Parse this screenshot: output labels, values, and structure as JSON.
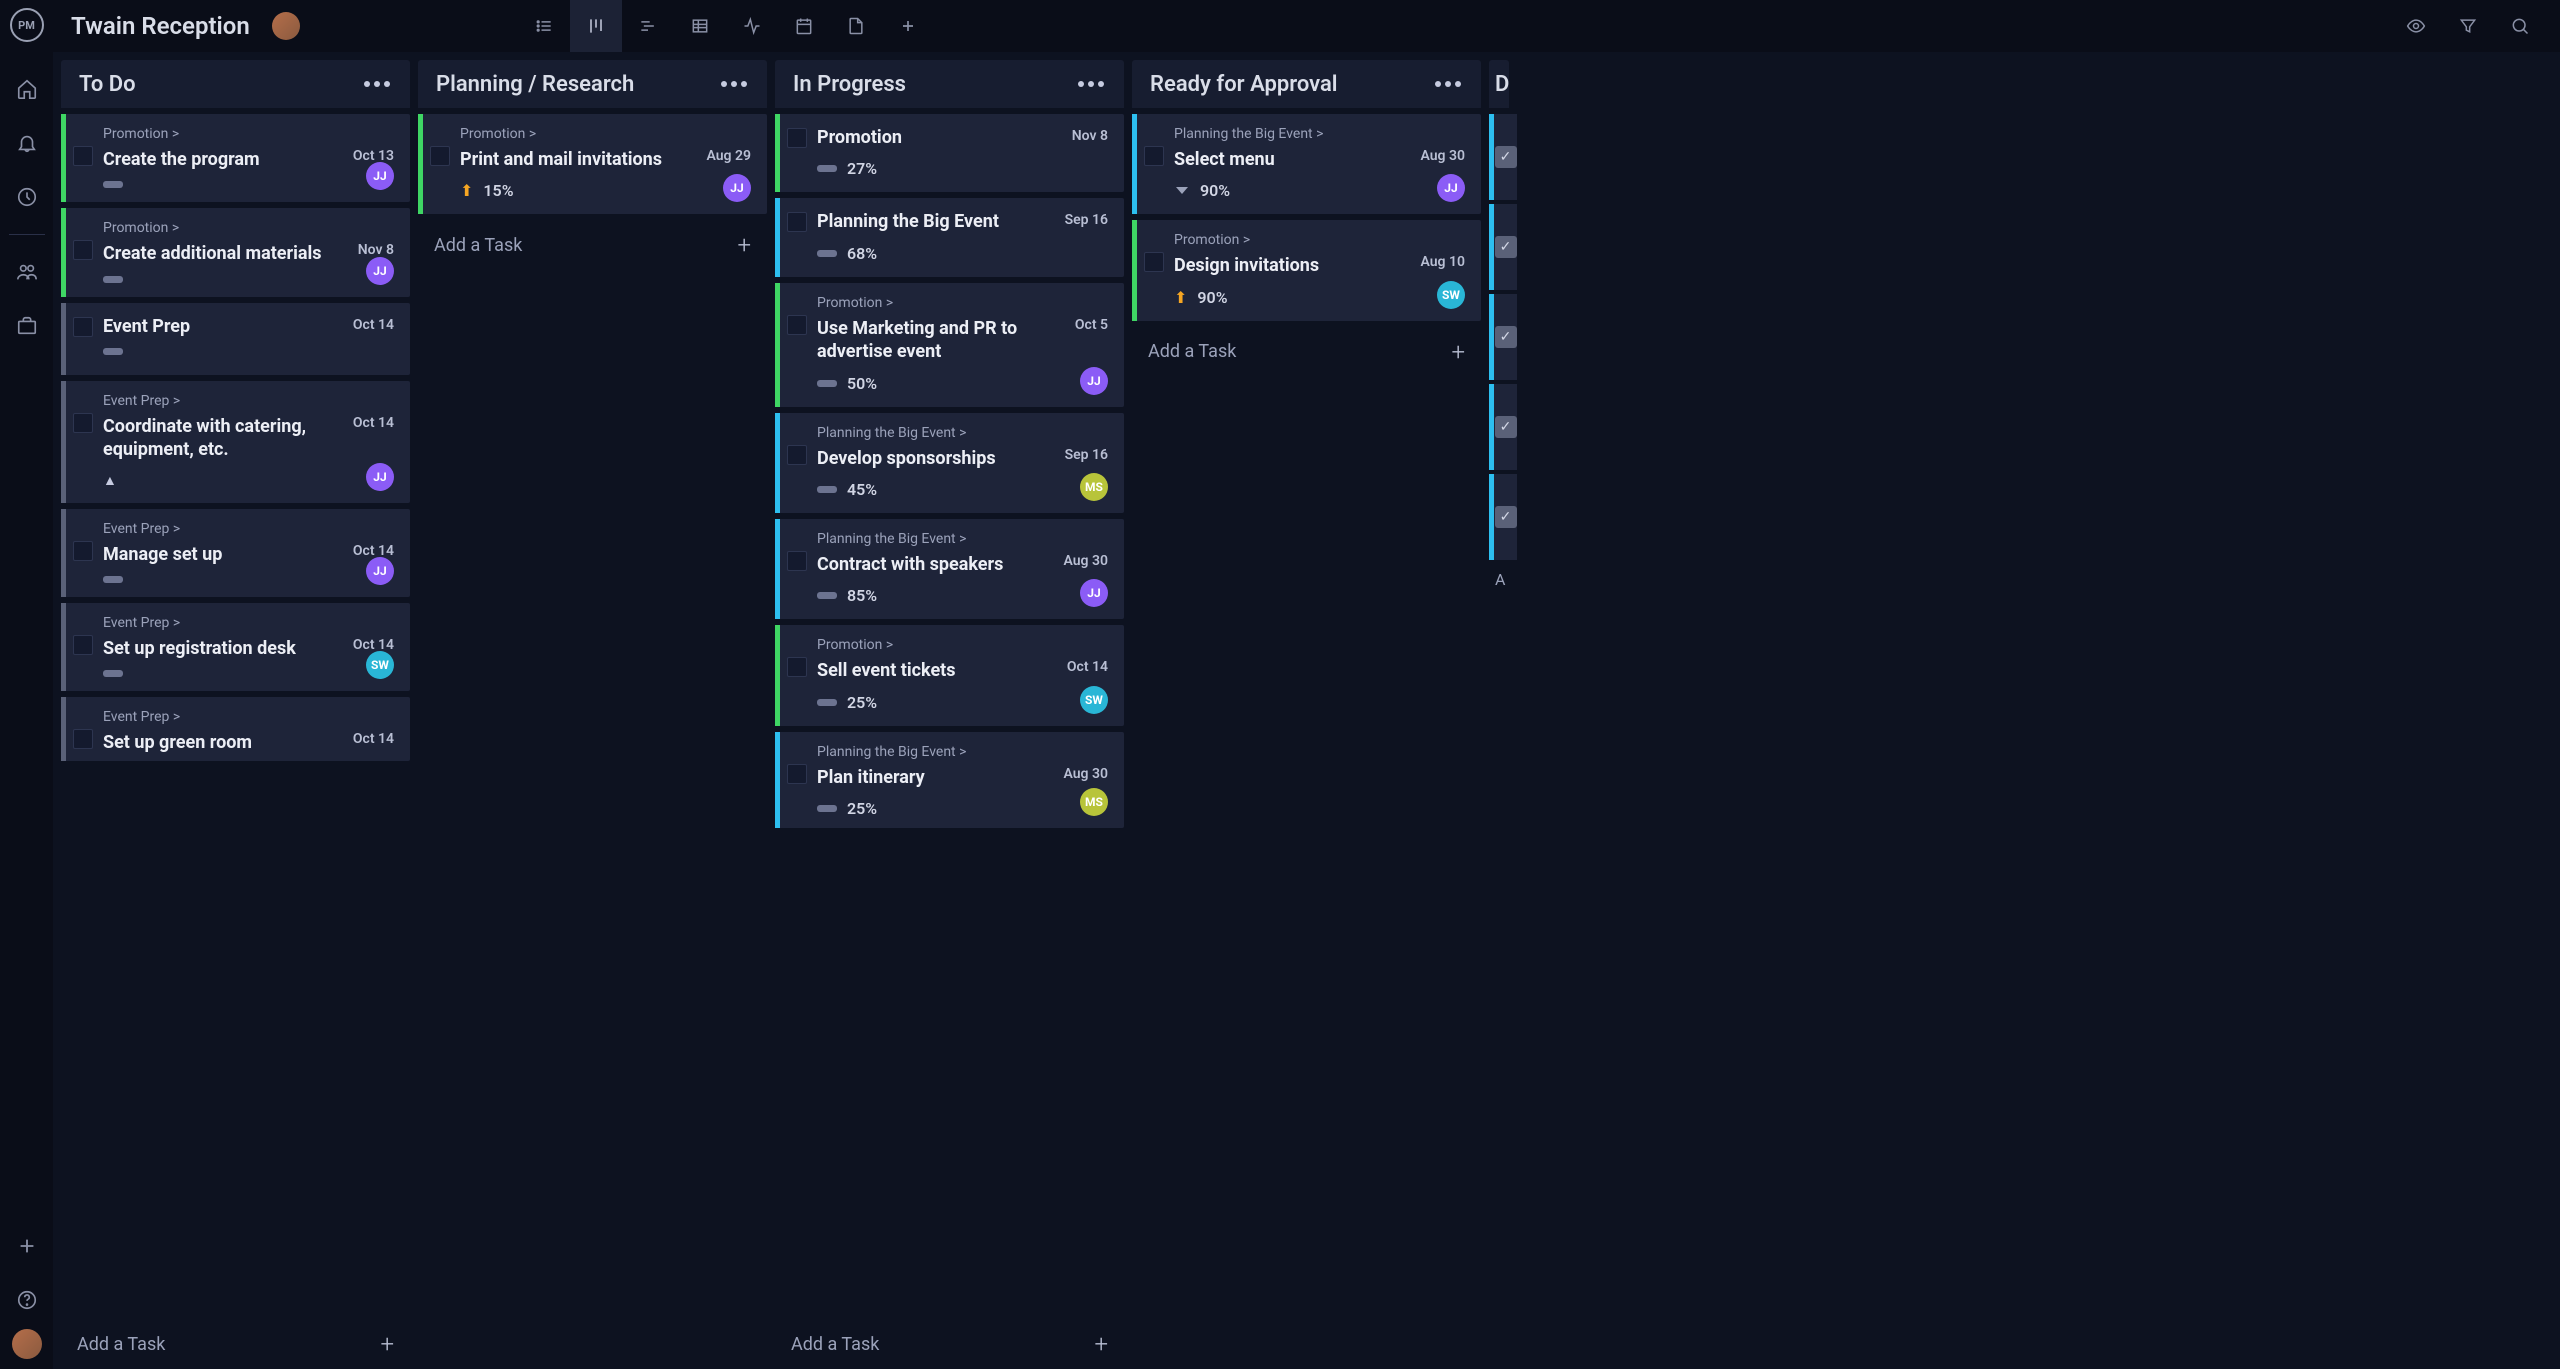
{
  "project": {
    "title": "Twain Reception"
  },
  "columns": [
    {
      "title": "To Do",
      "add_label": "Add a Task",
      "cards": [
        {
          "parent": "Promotion >",
          "title": "Create the program",
          "date": "Oct 13",
          "avatar": "JJ",
          "stripe": "green",
          "progress_bar": true
        },
        {
          "parent": "Promotion >",
          "title": "Create additional materials",
          "date": "Nov 8",
          "avatar": "JJ",
          "stripe": "green",
          "progress_bar": true
        },
        {
          "parent": "",
          "title": "Event Prep",
          "date": "Oct 14",
          "stripe": "gray",
          "header": true,
          "progress_bar": true
        },
        {
          "parent": "Event Prep >",
          "title": "Coordinate with catering, equipment, etc.",
          "date": "Oct 14",
          "avatar": "JJ",
          "stripe": "gray",
          "prio": "top"
        },
        {
          "parent": "Event Prep >",
          "title": "Manage set up",
          "date": "Oct 14",
          "avatar": "JJ",
          "stripe": "gray",
          "progress_bar": true
        },
        {
          "parent": "Event Prep >",
          "title": "Set up registration desk",
          "date": "Oct 14",
          "avatar": "SW",
          "stripe": "gray",
          "progress_bar": true
        },
        {
          "parent": "Event Prep >",
          "title": "Set up green room",
          "date": "Oct 14",
          "stripe": "gray"
        }
      ]
    },
    {
      "title": "Planning / Research",
      "add_label": "Add a Task",
      "cards": [
        {
          "parent": "Promotion >",
          "title": "Print and mail invitations",
          "date": "Aug 29",
          "avatar": "JJ",
          "stripe": "green",
          "prio": "up",
          "pct": "15%"
        }
      ]
    },
    {
      "title": "In Progress",
      "add_label": "Add a Task",
      "cards": [
        {
          "parent": "",
          "title": "Promotion",
          "date": "Nov 8",
          "stripe": "green",
          "header": true,
          "pct": "27%",
          "progress_bar": true
        },
        {
          "parent": "",
          "title": "Planning the Big Event",
          "date": "Sep 16",
          "stripe": "blue",
          "header": true,
          "pct": "68%",
          "progress_bar": true
        },
        {
          "parent": "Promotion >",
          "title": "Use Marketing and PR to advertise event",
          "date": "Oct 5",
          "avatar": "JJ",
          "stripe": "green",
          "pct": "50%",
          "progress_bar": true
        },
        {
          "parent": "Planning the Big Event >",
          "title": "Develop sponsorships",
          "date": "Sep 16",
          "avatar": "MS",
          "stripe": "blue",
          "pct": "45%",
          "progress_bar": true
        },
        {
          "parent": "Planning the Big Event >",
          "title": "Contract with speakers",
          "date": "Aug 30",
          "avatar": "JJ",
          "stripe": "blue",
          "pct": "85%",
          "progress_bar": true
        },
        {
          "parent": "Promotion >",
          "title": "Sell event tickets",
          "date": "Oct 14",
          "avatar": "SW",
          "stripe": "green",
          "pct": "25%",
          "progress_bar": true
        },
        {
          "parent": "Planning the Big Event >",
          "title": "Plan itinerary",
          "date": "Aug 30",
          "avatar": "MS",
          "stripe": "blue",
          "pct": "25%",
          "progress_bar": true
        }
      ]
    },
    {
      "title": "Ready for Approval",
      "add_label": "Add a Task",
      "cards": [
        {
          "parent": "Planning the Big Event >",
          "title": "Select menu",
          "date": "Aug 30",
          "avatar": "JJ",
          "stripe": "blue",
          "prio": "down",
          "pct": "90%"
        },
        {
          "parent": "Promotion >",
          "title": "Design invitations",
          "date": "Aug 10",
          "avatar": "SW",
          "stripe": "green",
          "prio": "up",
          "pct": "90%"
        }
      ]
    }
  ],
  "partial_column": {
    "title_first_letter": "D",
    "add_prefix": "A"
  }
}
